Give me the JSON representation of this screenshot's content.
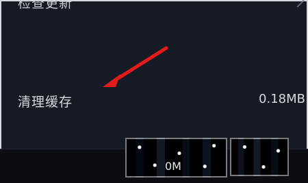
{
  "settings": {
    "check_update_label": "检查更新",
    "clear_cache_label": "清理缓存",
    "clear_cache_value": "0.18MB"
  },
  "bottom_panel": {
    "value_label": "0M"
  },
  "colors": {
    "background": "#161a24",
    "text": "#d6d9df",
    "annotation_arrow": "#e41b1b"
  },
  "icons": {
    "edge_icon": "chevron-right-icon",
    "annotation_icon": "red-arrow-icon"
  }
}
